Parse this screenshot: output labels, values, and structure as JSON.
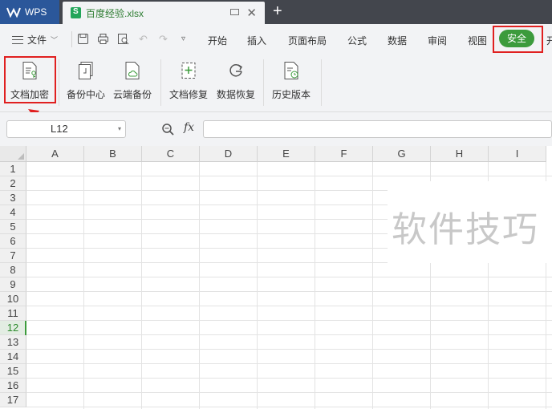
{
  "titlebar": {
    "app_tab": "WPS",
    "document_tab": "百度经验.xlsx"
  },
  "menubar": {
    "file_label": "文件",
    "items": [
      "开始",
      "插入",
      "页面布局",
      "公式",
      "数据",
      "审阅",
      "视图"
    ],
    "active_tab": "安全",
    "cut_off_tab": "开"
  },
  "ribbon": {
    "buttons": [
      "文档加密",
      "备份中心",
      "云端备份",
      "文档修复",
      "数据恢复",
      "历史版本"
    ]
  },
  "formula_bar": {
    "cell_reference": "L12",
    "fx_label": "fx",
    "formula_value": ""
  },
  "sheet": {
    "columns": [
      "A",
      "B",
      "C",
      "D",
      "E",
      "F",
      "G",
      "H",
      "I"
    ],
    "rows": [
      "1",
      "2",
      "3",
      "4",
      "5",
      "6",
      "7",
      "8",
      "9",
      "10",
      "11",
      "12",
      "13",
      "14",
      "15",
      "16",
      "17"
    ],
    "active_row": "12"
  },
  "watermark": "软件技巧",
  "colors": {
    "accent_green": "#3c9b3c",
    "highlight_red": "#e02020",
    "wps_blue": "#2b579a"
  }
}
